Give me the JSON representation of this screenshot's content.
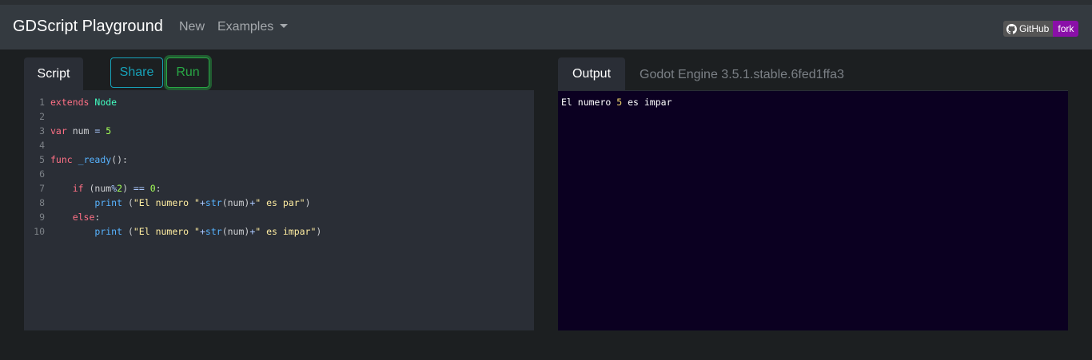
{
  "navbar": {
    "brand": "GDScript Playground",
    "new_label": "New",
    "examples_label": "Examples",
    "github_label": "GitHub",
    "fork_label": "fork"
  },
  "left": {
    "tab_label": "Script",
    "share_label": "Share",
    "run_label": "Run"
  },
  "right": {
    "tab_label": "Output",
    "engine_version": "Godot Engine 3.5.1.stable.6fed1ffa3"
  },
  "code_lines": [
    {
      "n": "1",
      "tokens": [
        [
          "kw",
          "extends"
        ],
        [
          "txt",
          " "
        ],
        [
          "cls",
          "Node"
        ]
      ]
    },
    {
      "n": "2",
      "tokens": []
    },
    {
      "n": "3",
      "tokens": [
        [
          "kw",
          "var"
        ],
        [
          "txt",
          " num "
        ],
        [
          "op",
          "="
        ],
        [
          "txt",
          " "
        ],
        [
          "num",
          "5"
        ]
      ]
    },
    {
      "n": "4",
      "tokens": []
    },
    {
      "n": "5",
      "tokens": [
        [
          "kw",
          "func"
        ],
        [
          "txt",
          " "
        ],
        [
          "fn",
          "_ready"
        ],
        [
          "txt",
          "():"
        ]
      ]
    },
    {
      "n": "6",
      "tokens": []
    },
    {
      "n": "7",
      "tokens": [
        [
          "txt",
          "    "
        ],
        [
          "kw",
          "if"
        ],
        [
          "txt",
          " (num"
        ],
        [
          "op",
          "%"
        ],
        [
          "num",
          "2"
        ],
        [
          "txt",
          ") "
        ],
        [
          "op",
          "=="
        ],
        [
          "txt",
          " "
        ],
        [
          "num",
          "0"
        ],
        [
          "txt",
          ":"
        ]
      ]
    },
    {
      "n": "8",
      "tokens": [
        [
          "txt",
          "        "
        ],
        [
          "fn",
          "print"
        ],
        [
          "txt",
          " ("
        ],
        [
          "str",
          "\"El numero \""
        ],
        [
          "op",
          "+"
        ],
        [
          "fn",
          "str"
        ],
        [
          "txt",
          "(num)"
        ],
        [
          "op",
          "+"
        ],
        [
          "str",
          "\" es par\""
        ],
        [
          "txt",
          ")"
        ]
      ]
    },
    {
      "n": "9",
      "tokens": [
        [
          "txt",
          "    "
        ],
        [
          "kw",
          "else"
        ],
        [
          "txt",
          ":"
        ]
      ]
    },
    {
      "n": "10",
      "tokens": [
        [
          "txt",
          "        "
        ],
        [
          "fn",
          "print"
        ],
        [
          "txt",
          " ("
        ],
        [
          "str",
          "\"El numero \""
        ],
        [
          "op",
          "+"
        ],
        [
          "fn",
          "str"
        ],
        [
          "txt",
          "(num)"
        ],
        [
          "op",
          "+"
        ],
        [
          "str",
          "\" es impar\""
        ],
        [
          "txt",
          ")"
        ]
      ]
    }
  ],
  "output": {
    "prefix": "El numero ",
    "number": "5",
    "suffix": " es impar"
  }
}
